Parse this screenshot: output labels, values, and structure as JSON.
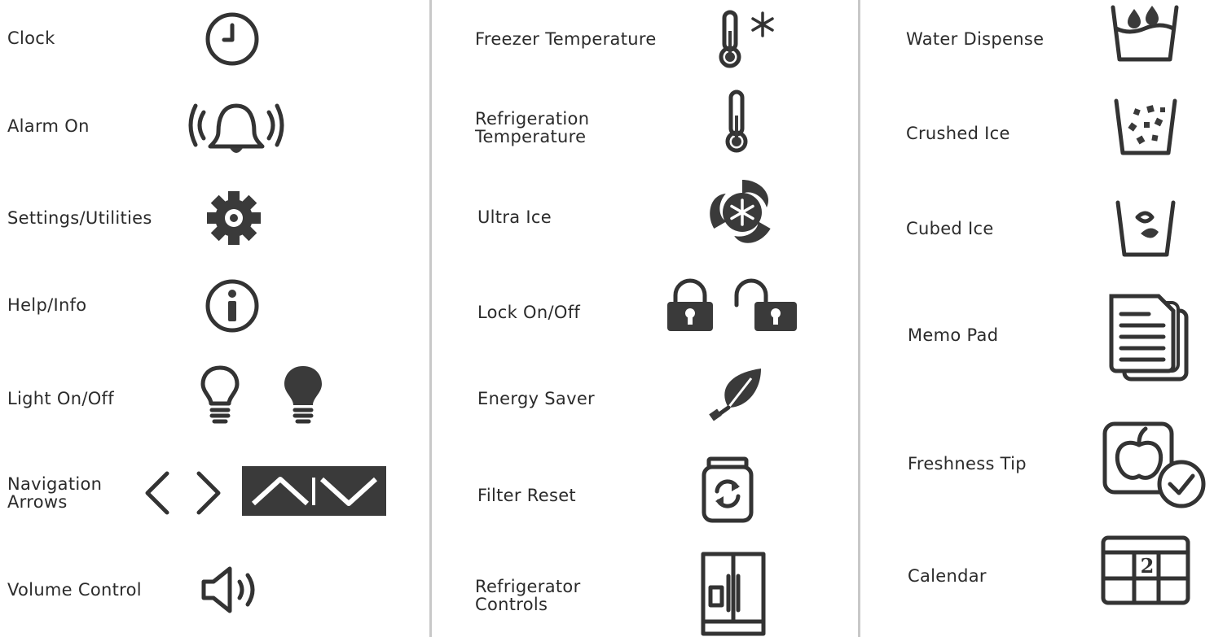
{
  "columns": [
    {
      "items": [
        {
          "label": "Clock",
          "icon": "clock-icon"
        },
        {
          "label": "Alarm On",
          "icon": "alarm-bell-icon"
        },
        {
          "label": "Settings/Utilities",
          "icon": "gear-icon"
        },
        {
          "label": "Help/Info",
          "icon": "info-icon"
        },
        {
          "label": "Light On/Off",
          "icon": "light-bulb-icon"
        },
        {
          "label": "Navigation Arrows",
          "icon": "navigation-arrows-icon"
        },
        {
          "label": "Volume Control",
          "icon": "speaker-icon"
        }
      ]
    },
    {
      "items": [
        {
          "label": "Freezer Temperature",
          "icon": "thermometer-snowflake-icon"
        },
        {
          "label": "Refrigeration Temperature",
          "icon": "thermometer-icon"
        },
        {
          "label": "Ultra Ice",
          "icon": "ultra-ice-icon"
        },
        {
          "label": "Lock On/Off",
          "icon": "padlock-icon"
        },
        {
          "label": "Energy Saver",
          "icon": "leaf-plug-icon"
        },
        {
          "label": "Filter Reset",
          "icon": "filter-reset-icon"
        },
        {
          "label": "Refrigerator Controls",
          "icon": "refrigerator-icon"
        }
      ]
    },
    {
      "items": [
        {
          "label": "Water Dispense",
          "icon": "water-glass-icon"
        },
        {
          "label": "Crushed Ice",
          "icon": "crushed-ice-icon"
        },
        {
          "label": "Cubed Ice",
          "icon": "cubed-ice-icon"
        },
        {
          "label": "Memo Pad",
          "icon": "memo-pad-icon"
        },
        {
          "label": "Freshness Tip",
          "icon": "apple-check-icon"
        },
        {
          "label": "Calendar",
          "icon": "calendar-icon"
        }
      ]
    }
  ],
  "calendar_day": "2",
  "colors": {
    "icon": "#333333",
    "divider": "#c8c8c8",
    "text": "#2b2b2b"
  }
}
